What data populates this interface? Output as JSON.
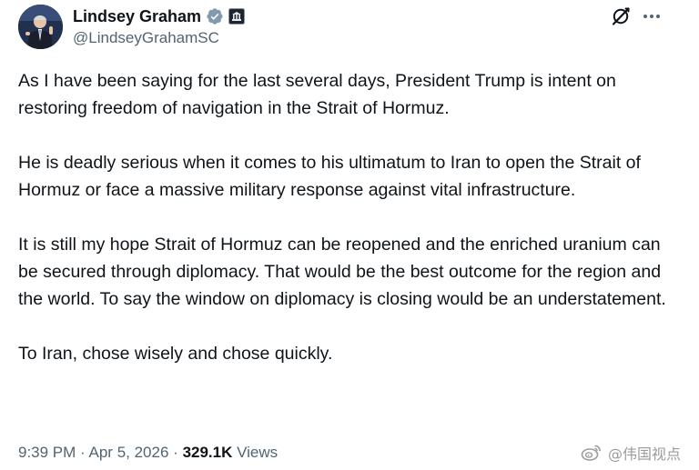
{
  "tweet": {
    "author": {
      "display_name": "Lindsey Graham",
      "handle": "@LindseyGrahamSC",
      "verified": true,
      "affiliation_badge": "government-badge-icon",
      "verified_color": "#829aab"
    },
    "actions": {
      "grok_icon": "grok-icon",
      "more_icon": "more-icon"
    },
    "paragraphs": [
      "As I have been saying for the last several days, President Trump is intent on restoring freedom of navigation in the Strait of Hormuz.",
      "He is deadly serious when it comes to his ultimatum to Iran to open the Strait of Hormuz or face a massive military response against vital infrastructure.",
      "It is still my hope Strait of Hormuz can be reopened and the enriched uranium can be secured through diplomacy. That would be the best outcome for the region and the world. To say the window on diplomacy is closing would be an understatement.",
      "To Iran, chose wisely and chose quickly."
    ],
    "meta": {
      "time": "9:39 PM",
      "separator": "·",
      "date": "Apr 5, 2026",
      "views_count": "329.1K",
      "views_label": "Views"
    }
  },
  "watermark": {
    "text": "@伟国视点",
    "icon": "weibo-icon"
  },
  "colors": {
    "text_primary": "#0f1419",
    "text_secondary": "#536471",
    "background": "#ffffff"
  }
}
